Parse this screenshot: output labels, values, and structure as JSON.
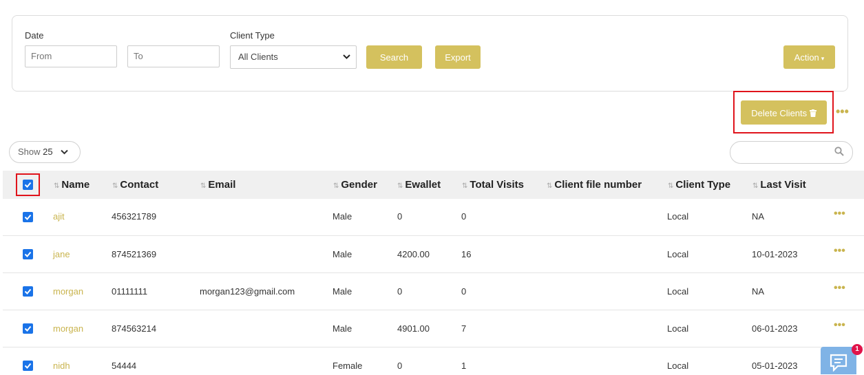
{
  "filters": {
    "date_label": "Date",
    "from_placeholder": "From",
    "to_placeholder": "To",
    "client_type_label": "Client Type",
    "client_type_selected": "All Clients",
    "search_label": "Search",
    "export_label": "Export",
    "action_label": "Action"
  },
  "toolbar": {
    "delete_label": "Delete Clients"
  },
  "table_controls": {
    "show_prefix": "Show",
    "show_value": "25",
    "search_placeholder": ""
  },
  "table": {
    "columns": [
      "Name",
      "Contact",
      "Email",
      "Gender",
      "Ewallet",
      "Total Visits",
      "Client file number",
      "Client Type",
      "Last Visit"
    ],
    "rows": [
      {
        "name": "ajit",
        "contact": "456321789",
        "email": "",
        "gender": "Male",
        "ewallet": "0",
        "visits": "0",
        "file": "",
        "type": "Local",
        "last": "NA"
      },
      {
        "name": "jane",
        "contact": "874521369",
        "email": "",
        "gender": "Male",
        "ewallet": "4200.00",
        "visits": "16",
        "file": "",
        "type": "Local",
        "last": "10-01-2023"
      },
      {
        "name": "morgan",
        "contact": "01111111",
        "email": "morgan123@gmail.com",
        "gender": "Male",
        "ewallet": "0",
        "visits": "0",
        "file": "",
        "type": "Local",
        "last": "NA"
      },
      {
        "name": "morgan",
        "contact": "874563214",
        "email": "",
        "gender": "Male",
        "ewallet": "4901.00",
        "visits": "7",
        "file": "",
        "type": "Local",
        "last": "06-01-2023"
      },
      {
        "name": "nidh",
        "contact": "54444",
        "email": "",
        "gender": "Female",
        "ewallet": "0",
        "visits": "1",
        "file": "",
        "type": "Local",
        "last": "05-01-2023"
      }
    ]
  },
  "chat": {
    "badge_count": "1"
  },
  "colors": {
    "accent": "#d4c15e",
    "checkbox": "#1a73e8",
    "highlight": "#e0131b"
  }
}
